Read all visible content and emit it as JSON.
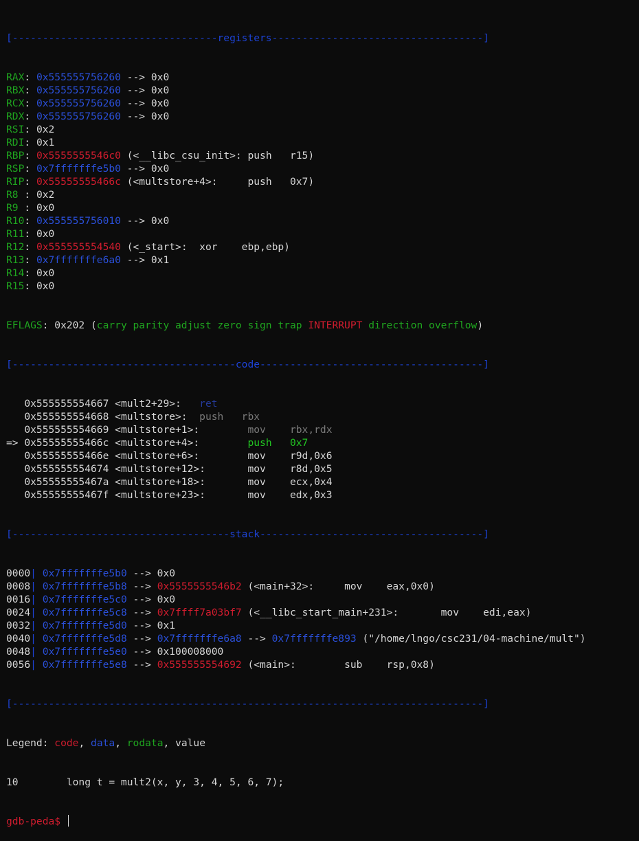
{
  "colors": {
    "background": "#0c0c0c",
    "foreground": "#d6d6d6",
    "separator": "#1d43d6",
    "register_name": "#1fa51f",
    "data_address": "#2a4fd8",
    "code_address": "#d01c2e",
    "rodata": "#1fa51f",
    "current_instruction": "#22c522"
  },
  "sections": {
    "registers": "[----------------------------------registers-----------------------------------]",
    "code": "[-------------------------------------code-------------------------------------]",
    "stack": "[------------------------------------stack-------------------------------------]",
    "end": "[------------------------------------------------------------------------------]"
  },
  "registers": [
    {
      "name": "RAX",
      "sep": ": ",
      "addr": "0x555555756260",
      "addr_type": "blue",
      "rest": " --> 0x0"
    },
    {
      "name": "RBX",
      "sep": ": ",
      "addr": "0x555555756260",
      "addr_type": "blue",
      "rest": " --> 0x0"
    },
    {
      "name": "RCX",
      "sep": ": ",
      "addr": "0x555555756260",
      "addr_type": "blue",
      "rest": " --> 0x0"
    },
    {
      "name": "RDX",
      "sep": ": ",
      "addr": "0x555555756260",
      "addr_type": "blue",
      "rest": " --> 0x0"
    },
    {
      "name": "RSI",
      "sep": ": ",
      "value": "0x2"
    },
    {
      "name": "RDI",
      "sep": ": ",
      "value": "0x1"
    },
    {
      "name": "RBP",
      "sep": ": ",
      "addr": "0x5555555546c0",
      "addr_type": "red",
      "rest": " (<__libc_csu_init>: push   r15)"
    },
    {
      "name": "RSP",
      "sep": ": ",
      "addr": "0x7fffffffe5b0",
      "addr_type": "blue",
      "rest": " --> 0x0"
    },
    {
      "name": "RIP",
      "sep": ": ",
      "addr": "0x55555555466c",
      "addr_type": "red",
      "rest": " (<multstore+4>:     push   0x7)"
    },
    {
      "name": "R8",
      "sep": " : ",
      "value": "0x2"
    },
    {
      "name": "R9",
      "sep": " : ",
      "value": "0x0"
    },
    {
      "name": "R10",
      "sep": ": ",
      "addr": "0x555555756010",
      "addr_type": "blue",
      "rest": " --> 0x0"
    },
    {
      "name": "R11",
      "sep": ": ",
      "value": "0x0"
    },
    {
      "name": "R12",
      "sep": ": ",
      "addr": "0x555555554540",
      "addr_type": "red",
      "rest": " (<_start>:  xor    ebp,ebp)"
    },
    {
      "name": "R13",
      "sep": ": ",
      "addr": "0x7fffffffe6a0",
      "addr_type": "blue",
      "rest": " --> 0x1"
    },
    {
      "name": "R14",
      "sep": ": ",
      "value": "0x0"
    },
    {
      "name": "R15",
      "sep": ": ",
      "value": "0x0"
    }
  ],
  "eflags": {
    "label": "EFLAGS",
    "value": ": 0x202 (",
    "flags_pre": "carry parity adjust zero sign trap ",
    "flag_set": "INTERRUPT",
    "flags_post": " direction overflow",
    "close": ")"
  },
  "code": [
    {
      "prefix": "   ",
      "addr": "0x555555554667",
      "sym": " <mult2+29>:   ",
      "instr": "ret",
      "style": "dimret"
    },
    {
      "prefix": "   ",
      "addr": "0x555555554668",
      "sym": " <multstore>:  ",
      "instr": "push   rbx",
      "style": "dim"
    },
    {
      "prefix": "   ",
      "addr": "0x555555554669",
      "sym": " <multstore+1>:        ",
      "instr": "mov    rbx,rdx",
      "style": "dim"
    },
    {
      "prefix": "=> ",
      "addr": "0x55555555466c",
      "sym": " <multstore+4>:        ",
      "instr": "push   0x7",
      "style": "pgreen"
    },
    {
      "prefix": "   ",
      "addr": "0x55555555466e",
      "sym": " <multstore+6>:        ",
      "instr": "mov    r9d,0x6",
      "style": "wht"
    },
    {
      "prefix": "   ",
      "addr": "0x555555554674",
      "sym": " <multstore+12>:       ",
      "instr": "mov    r8d,0x5",
      "style": "wht"
    },
    {
      "prefix": "   ",
      "addr": "0x55555555467a",
      "sym": " <multstore+18>:       ",
      "instr": "mov    ecx,0x4",
      "style": "wht"
    },
    {
      "prefix": "   ",
      "addr": "0x55555555467f",
      "sym": " <multstore+23>:       ",
      "instr": "mov    edx,0x3",
      "style": "wht"
    }
  ],
  "stack": [
    {
      "offset": "0000",
      "addr": "0x7fffffffe5b0",
      "segs": [
        {
          "t": " --> 0x0",
          "c": "wht"
        }
      ]
    },
    {
      "offset": "0008",
      "addr": "0x7fffffffe5b8",
      "segs": [
        {
          "t": " --> ",
          "c": "wht"
        },
        {
          "t": "0x5555555546b2",
          "c": "red"
        },
        {
          "t": " (<main+32>:     mov    eax,0x0)",
          "c": "wht"
        }
      ]
    },
    {
      "offset": "0016",
      "addr": "0x7fffffffe5c0",
      "segs": [
        {
          "t": " --> 0x0",
          "c": "wht"
        }
      ]
    },
    {
      "offset": "0024",
      "addr": "0x7fffffffe5c8",
      "segs": [
        {
          "t": " --> ",
          "c": "wht"
        },
        {
          "t": "0x7ffff7a03bf7",
          "c": "red"
        },
        {
          "t": " (<__libc_start_main+231>:       mov    edi,eax)",
          "c": "wht"
        }
      ]
    },
    {
      "offset": "0032",
      "addr": "0x7fffffffe5d0",
      "segs": [
        {
          "t": " --> 0x1",
          "c": "wht"
        }
      ]
    },
    {
      "offset": "0040",
      "addr": "0x7fffffffe5d8",
      "segs": [
        {
          "t": " --> ",
          "c": "wht"
        },
        {
          "t": "0x7fffffffe6a8",
          "c": "blue"
        },
        {
          "t": " --> ",
          "c": "wht"
        },
        {
          "t": "0x7fffffffe893",
          "c": "blue"
        },
        {
          "t": " (\"/home/lngo/csc231/04-machine/mult\")",
          "c": "wht"
        }
      ]
    },
    {
      "offset": "0048",
      "addr": "0x7fffffffe5e0",
      "segs": [
        {
          "t": " --> 0x100008000",
          "c": "wht"
        }
      ]
    },
    {
      "offset": "0056",
      "addr": "0x7fffffffe5e8",
      "segs": [
        {
          "t": " --> ",
          "c": "wht"
        },
        {
          "t": "0x555555554692",
          "c": "red"
        },
        {
          "t": " (<main>:        sub    rsp,0x8)",
          "c": "wht"
        }
      ]
    }
  ],
  "legend": {
    "label": "Legend: ",
    "code": "code",
    "comma1": ", ",
    "data": "data",
    "comma2": ", ",
    "rodata": "rodata",
    "comma3": ", ",
    "value": "value"
  },
  "source_line": "10        long t = mult2(x, y, 3, 4, 5, 6, 7);",
  "prompt": "gdb-peda$ "
}
